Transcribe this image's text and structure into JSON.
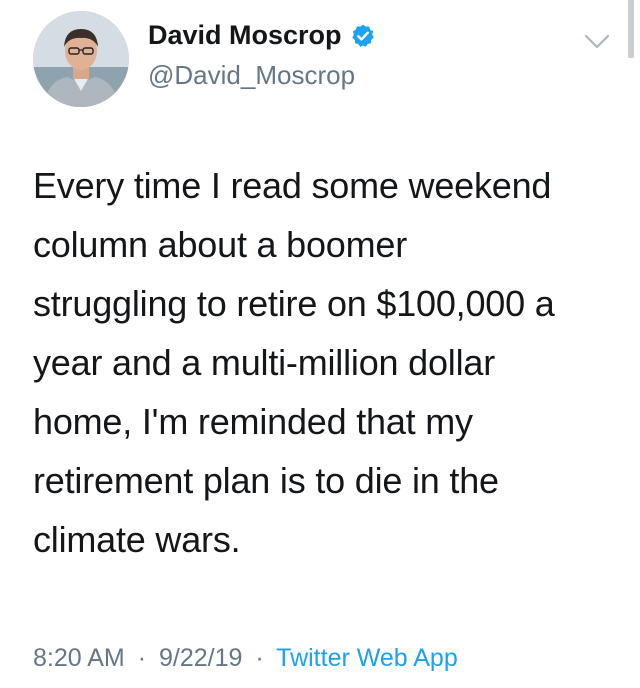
{
  "author": {
    "display_name": "David Moscrop",
    "handle": "@David_Moscrop",
    "verified": true
  },
  "tweet": {
    "text": "Every time I read some weekend\ncolumn about a boomer\nstruggling to retire on $100,000 a\nyear and a multi-million dollar\nhome, I'm reminded that my\nretirement plan is to die in the\nclimate wars."
  },
  "meta": {
    "time": "8:20 AM",
    "date": "9/22/19",
    "separator": "·",
    "source": "Twitter Web App"
  },
  "colors": {
    "text": "#14171a",
    "secondary": "#657786",
    "accent": "#1da1f2"
  },
  "icons": {
    "verified": "verified-badge-icon",
    "menu": "chevron-down-icon"
  }
}
